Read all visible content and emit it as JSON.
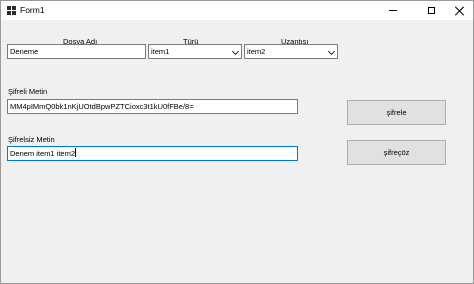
{
  "window": {
    "title": "Form1"
  },
  "labels": {
    "file_name": "Dosya Adı",
    "type": "Türü",
    "extension": "Uzantısı",
    "encrypted_text": "Şifreli Metin",
    "plain_text": "Şifrelsiz Metin"
  },
  "inputs": {
    "file_name_value": "Deneme",
    "type_selected": "item1",
    "extension_selected": "item2",
    "encrypted_value": "MM4pIMmQ0bk1nKjUOtdBpwPZTCioxc3t1kU0fFBe/8=",
    "plain_value": "Denem item1 item2"
  },
  "buttons": {
    "encrypt": "şifrele",
    "decrypt": "şifreçöz"
  }
}
